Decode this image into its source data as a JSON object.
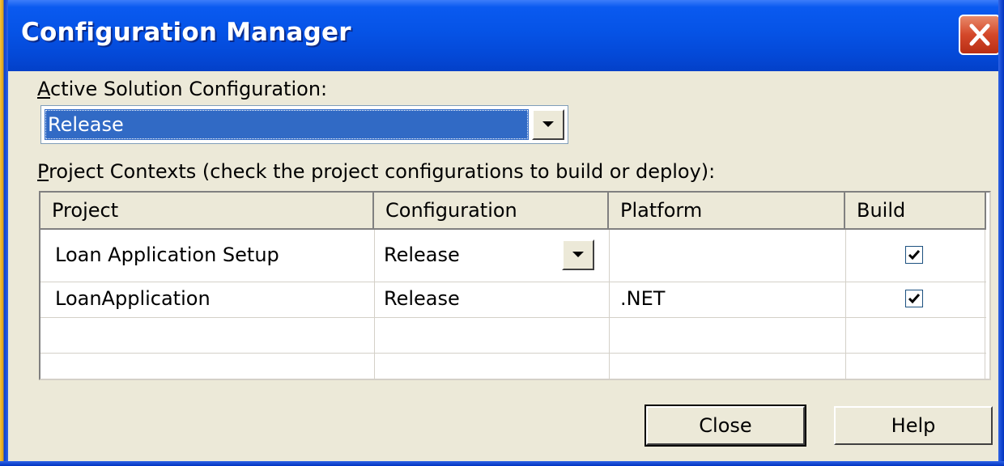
{
  "window": {
    "title": "Configuration Manager"
  },
  "active_config": {
    "label_accel": "A",
    "label_rest": "ctive Solution Configuration:",
    "value": "Release"
  },
  "contexts": {
    "label_accel": "P",
    "label_rest": "roject Contexts (check the project configurations to build or deploy):"
  },
  "table": {
    "columns": [
      "Project",
      "Configuration",
      "Platform",
      "Build"
    ],
    "rows": [
      {
        "project": "Loan Application Setup",
        "configuration": "Release",
        "platform": "",
        "build": true
      },
      {
        "project": "LoanApplication",
        "configuration": "Release",
        "platform": ".NET",
        "build": true
      }
    ]
  },
  "buttons": {
    "close": "Close",
    "help": "Help"
  },
  "colors": {
    "titlebar": "#0653e6",
    "selection": "#316ac5",
    "face": "#ece9d8"
  },
  "icons": [
    "close-icon",
    "dropdown-arrow-icon",
    "checkmark-icon"
  ]
}
